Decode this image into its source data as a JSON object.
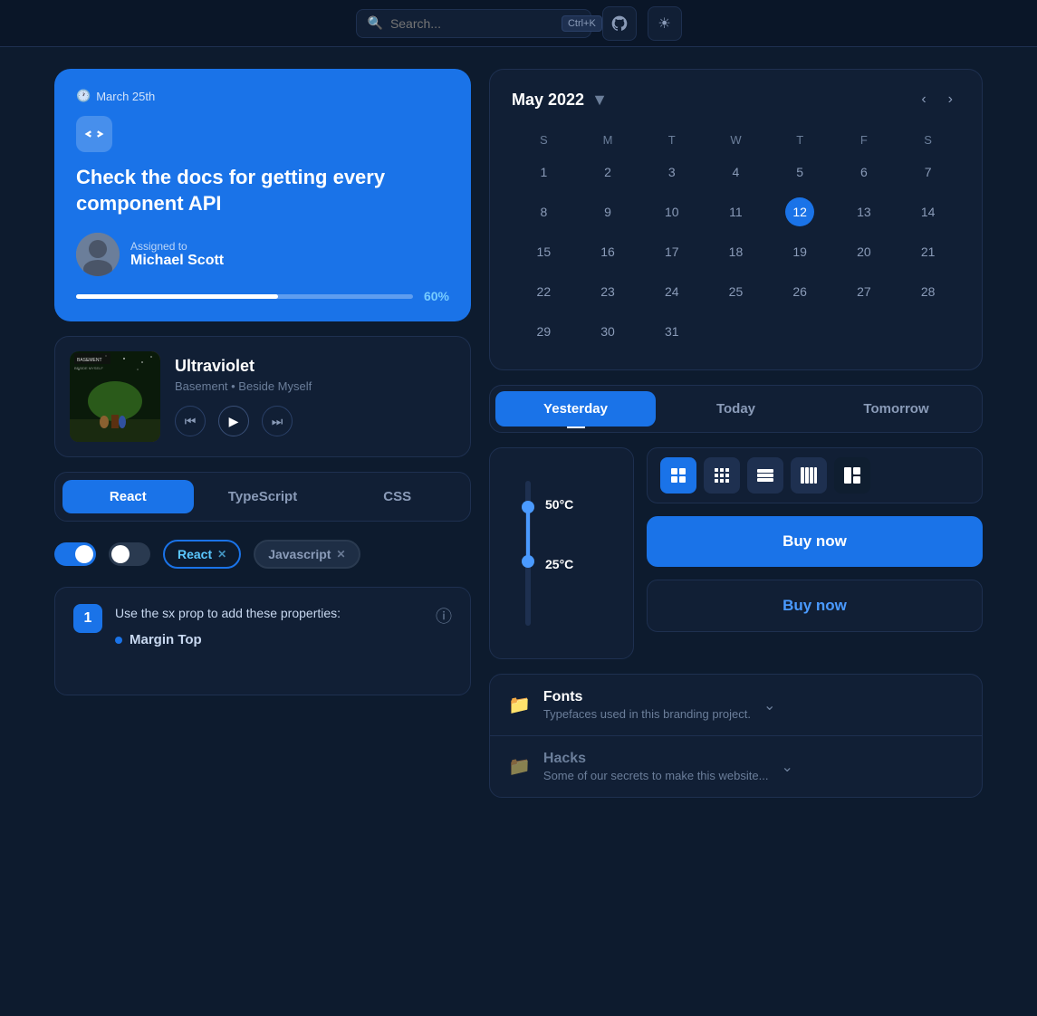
{
  "nav": {
    "search_placeholder": "Search...",
    "kbd_shortcut": "Ctrl+K",
    "github_icon": "github-icon",
    "theme_icon": "theme-icon"
  },
  "task_card": {
    "date": "March 25th",
    "title": "Check the docs for getting every component API",
    "assigned_label": "Assigned to",
    "assigned_name": "Michael Scott",
    "progress_pct": 60,
    "progress_label": "60%"
  },
  "music_card": {
    "title": "Ultraviolet",
    "subtitle": "Basement • Beside Myself"
  },
  "tabs": {
    "items": [
      {
        "label": "React",
        "active": true
      },
      {
        "label": "TypeScript",
        "active": false
      },
      {
        "label": "CSS",
        "active": false
      }
    ]
  },
  "toggles": {
    "toggle1_on": true,
    "toggle2_on": false,
    "chip1_label": "React",
    "chip2_label": "Javascript"
  },
  "instruction": {
    "step": "1",
    "text": "Use the sx prop to add these properties:",
    "bullet": "Margin Top"
  },
  "calendar": {
    "month_year": "May 2022",
    "days_of_week": [
      "S",
      "M",
      "T",
      "W",
      "T",
      "F",
      "S"
    ],
    "today": 12,
    "rows": [
      [
        null,
        null,
        null,
        null,
        null,
        null,
        1,
        2,
        3,
        4,
        5,
        6,
        7
      ],
      [
        8,
        9,
        10,
        11,
        12,
        13,
        14
      ],
      [
        15,
        16,
        17,
        18,
        19,
        20,
        21
      ],
      [
        22,
        23,
        24,
        25,
        26,
        27,
        28
      ],
      [
        29,
        30,
        31,
        null,
        null,
        null,
        null
      ]
    ]
  },
  "tabs2": {
    "items": [
      {
        "label": "Yesterday",
        "active": true
      },
      {
        "label": "Today",
        "active": false
      },
      {
        "label": "Tomorrow",
        "active": false
      }
    ]
  },
  "thermometer": {
    "high_temp": "50°C",
    "low_temp": "25°C"
  },
  "icon_groups": {
    "icons": [
      "⊞",
      "⊟",
      "≡",
      "⦿",
      "◫"
    ]
  },
  "buy_buttons": {
    "primary_label": "Buy now",
    "secondary_label": "Buy now"
  },
  "accordion": {
    "items": [
      {
        "label": "Fonts",
        "desc": "Typefaces used in this branding project.",
        "muted": false
      },
      {
        "label": "Hacks",
        "desc": "Some of our secrets to make this website...",
        "muted": true
      }
    ]
  }
}
